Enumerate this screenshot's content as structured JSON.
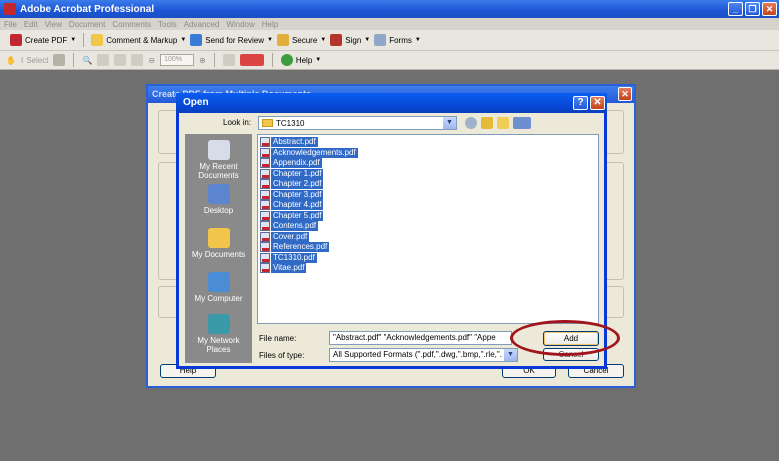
{
  "app": {
    "title": "Adobe Acrobat Professional",
    "window_buttons": [
      "_",
      "❐",
      "✕"
    ]
  },
  "menu": [
    "File",
    "Edit",
    "View",
    "Document",
    "Comments",
    "Tools",
    "Advanced",
    "Window",
    "Help"
  ],
  "toolbar1": {
    "create_pdf": "Create PDF",
    "comment_markup": "Comment & Markup",
    "send_review": "Send for Review",
    "secure": "Secure",
    "sign": "Sign",
    "forms": "Forms"
  },
  "toolbar2": {
    "select": "Select",
    "zoom": "100%",
    "help": "Help"
  },
  "bg_dialog": {
    "title": "Create PDF from Multiple Documents",
    "help_button": "Help",
    "ok_button": "OK",
    "cancel_button": "Cancel"
  },
  "open_dialog": {
    "title": "Open",
    "help_btn": "?",
    "close_btn": "✕",
    "look_in_label": "Look in:",
    "look_in_value": "TC1310",
    "places": [
      {
        "label": "My Recent Documents"
      },
      {
        "label": "Desktop"
      },
      {
        "label": "My Documents"
      },
      {
        "label": "My Computer"
      },
      {
        "label": "My Network Places"
      }
    ],
    "files": [
      "Abstract.pdf",
      "Acknowledgements.pdf",
      "Appendix.pdf",
      "Chapter 1.pdf",
      "Chapter 2.pdf",
      "Chapter 3.pdf",
      "Chapter 4.pdf",
      "Chapter 5.pdf",
      "Contens.pdf",
      "Cover.pdf",
      "References.pdf",
      "TC1310.pdf",
      "Vitae.pdf"
    ],
    "file_name_label": "File name:",
    "file_name_value": "\"Abstract.pdf\" \"Acknowledgements.pdf\" \"Appe",
    "files_of_type_label": "Files of type:",
    "files_of_type_value": "All Supported Formats (\".pdf,\".dwg,\".bmp,\".rle,\".",
    "add_button": "Add",
    "cancel_button": "Cancel"
  },
  "colors": {
    "titlebar": "#1c55d6",
    "selection": "#316ac5",
    "highlight_ellipse": "#a0161c"
  }
}
